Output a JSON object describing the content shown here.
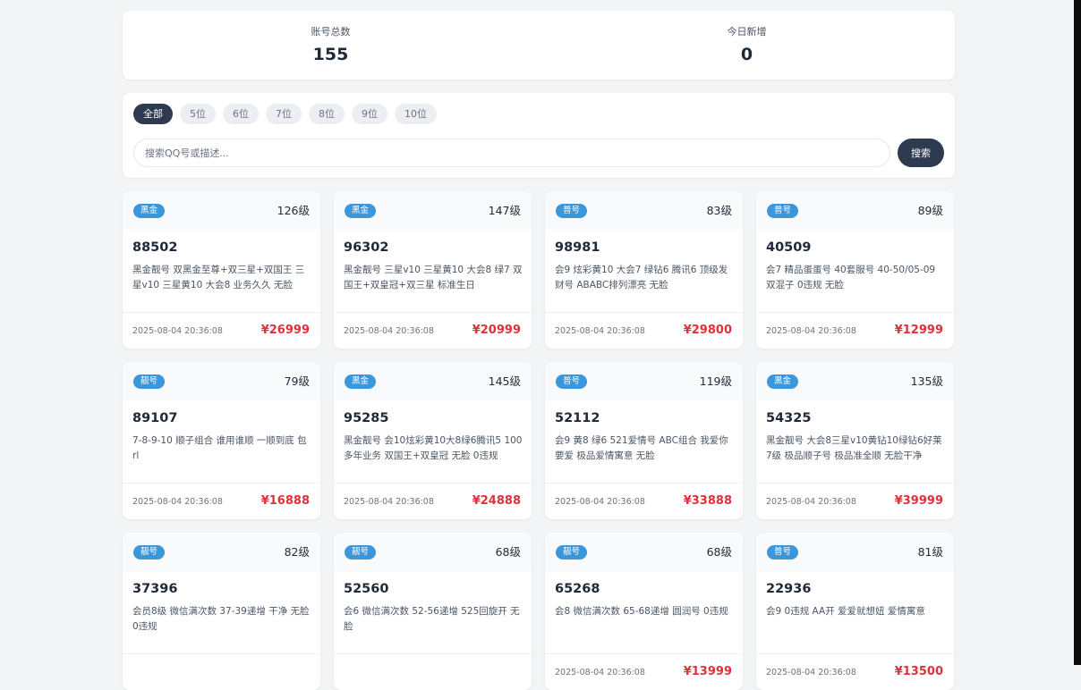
{
  "stats": {
    "total_label": "账号总数",
    "total_value": "155",
    "today_label": "今日新增",
    "today_value": "0"
  },
  "filters": [
    {
      "label": "全部",
      "active": true
    },
    {
      "label": "5位",
      "active": false
    },
    {
      "label": "6位",
      "active": false
    },
    {
      "label": "7位",
      "active": false
    },
    {
      "label": "8位",
      "active": false
    },
    {
      "label": "9位",
      "active": false
    },
    {
      "label": "10位",
      "active": false
    }
  ],
  "search": {
    "placeholder": "搜索QQ号或描述...",
    "value": "",
    "button_label": "搜索"
  },
  "colors": {
    "primary": "#2d3a4f",
    "badge": "#3b97dc",
    "price": "#e0313b"
  },
  "cards": [
    {
      "tag": "黑金",
      "level": "126级",
      "qq": "88502",
      "desc": "黑金靓号 双黑金至尊+双三星+双国王 三星v10 三星黄10 大会8 业务久久 无脸",
      "time": "2025-08-04 20:36:08",
      "price": "¥26999"
    },
    {
      "tag": "黑金",
      "level": "147级",
      "qq": "96302",
      "desc": "黑金靓号 三星v10 三星黄10 大会8 绿7 双国王+双皇冠+双三星 标准生日",
      "time": "2025-08-04 20:36:08",
      "price": "¥20999"
    },
    {
      "tag": "普号",
      "level": "83级",
      "qq": "98981",
      "desc": "会9 炫彩黄10 大会7 绿钻6 腾讯6 顶级发财号 ABABC排列漂亮 无脸",
      "time": "2025-08-04 20:36:08",
      "price": "¥29800"
    },
    {
      "tag": "普号",
      "level": "89级",
      "qq": "40509",
      "desc": "会7 精品蛋蛋号 40套服号 40-50/05-09 双混子 0违规 无脸",
      "time": "2025-08-04 20:36:08",
      "price": "¥12999"
    },
    {
      "tag": "靓号",
      "level": "79级",
      "qq": "89107",
      "desc": "7-8-9-10 顺子组合 谁用谁顺 一顺到底 包rl",
      "time": "2025-08-04 20:36:08",
      "price": "¥16888"
    },
    {
      "tag": "黑金",
      "level": "145级",
      "qq": "95285",
      "desc": "黑金靓号 会10炫彩黄10大8绿6腾讯5 100多年业务 双国王+双皇冠 无脸 0违规",
      "time": "2025-08-04 20:36:08",
      "price": "¥24888"
    },
    {
      "tag": "普号",
      "level": "119级",
      "qq": "52112",
      "desc": "会9 黄8 绿6 521爱情号 ABC组合 我爱你要爱 极品爱情寓意 无脸",
      "time": "2025-08-04 20:36:08",
      "price": "¥33888"
    },
    {
      "tag": "黑金",
      "level": "135级",
      "qq": "54325",
      "desc": "黑金靓号 大会8三星v10黄钻10绿钻6好莱7级 极品顺子号 极品准全顺 无脸干净",
      "time": "2025-08-04 20:36:08",
      "price": "¥39999"
    },
    {
      "tag": "靓号",
      "level": "82级",
      "qq": "37396",
      "desc": "会员8级 微信满次数 37-39递增 干净 无脸 0违规",
      "time": "",
      "price": ""
    },
    {
      "tag": "靓号",
      "level": "68级",
      "qq": "52560",
      "desc": "会6 微信满次数 52-56递增 525回旋开 无脸",
      "time": "",
      "price": ""
    },
    {
      "tag": "靓号",
      "level": "68级",
      "qq": "65268",
      "desc": "会8 微信满次数 65-68递增 圆润号 0违规",
      "time": "2025-08-04 20:36:08",
      "price": "¥13999"
    },
    {
      "tag": "普号",
      "level": "81级",
      "qq": "22936",
      "desc": "会9 0违规 AA开 爱爱就想妞 爱情寓意",
      "time": "2025-08-04 20:36:08",
      "price": "¥13500"
    }
  ]
}
